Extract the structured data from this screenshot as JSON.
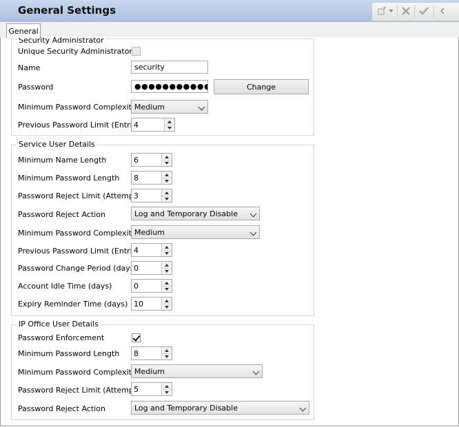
{
  "header": {
    "title": "General Settings"
  },
  "toolbar": {
    "icons": [
      "new-icon",
      "dropdown-icon",
      "cancel-icon",
      "ok-icon",
      "back-icon"
    ]
  },
  "tabs": [
    {
      "label": "General"
    }
  ],
  "security_admin": {
    "legend": "Security Administrator",
    "unique_label": "Unique Security Administrator",
    "unique_checked": false,
    "name_label": "Name",
    "name_value": "security",
    "password_label": "Password",
    "password_value": "●●●●●●●●●●●●●●●",
    "change_button": "Change",
    "complexity_label": "Minimum Password Complexity",
    "complexity_value": "Medium",
    "prev_limit_label": "Previous Password Limit (Entries)",
    "prev_limit_value": "4"
  },
  "service_user": {
    "legend": "Service User Details",
    "min_name_label": "Minimum Name Length",
    "min_name_value": "6",
    "min_pw_label": "Minimum Password Length",
    "min_pw_value": "8",
    "reject_limit_label": "Password Reject Limit (Attempts)",
    "reject_limit_value": "3",
    "reject_action_label": "Password Reject Action",
    "reject_action_value": "Log and Temporary Disable",
    "complexity_label": "Minimum Password Complexity",
    "complexity_value": "Medium",
    "prev_limit_label": "Previous Password Limit (Entries)",
    "prev_limit_value": "4",
    "change_period_label": "Password Change Period (days)",
    "change_period_value": "0",
    "idle_label": "Account Idle Time (days)",
    "idle_value": "0",
    "expiry_label": "Expiry Reminder Time (days)",
    "expiry_value": "10"
  },
  "ip_office": {
    "legend": "IP Office User Details",
    "enforcement_label": "Password Enforcement",
    "enforcement_checked": true,
    "min_pw_label": "Minimum Password Length",
    "min_pw_value": "8",
    "complexity_label": "Minimum Password Complexity",
    "complexity_value": "Medium",
    "reject_limit_label": "Password Reject Limit (Attempts)",
    "reject_limit_value": "5",
    "reject_action_label": "Password Reject Action",
    "reject_action_value": "Log and Temporary Disable"
  }
}
